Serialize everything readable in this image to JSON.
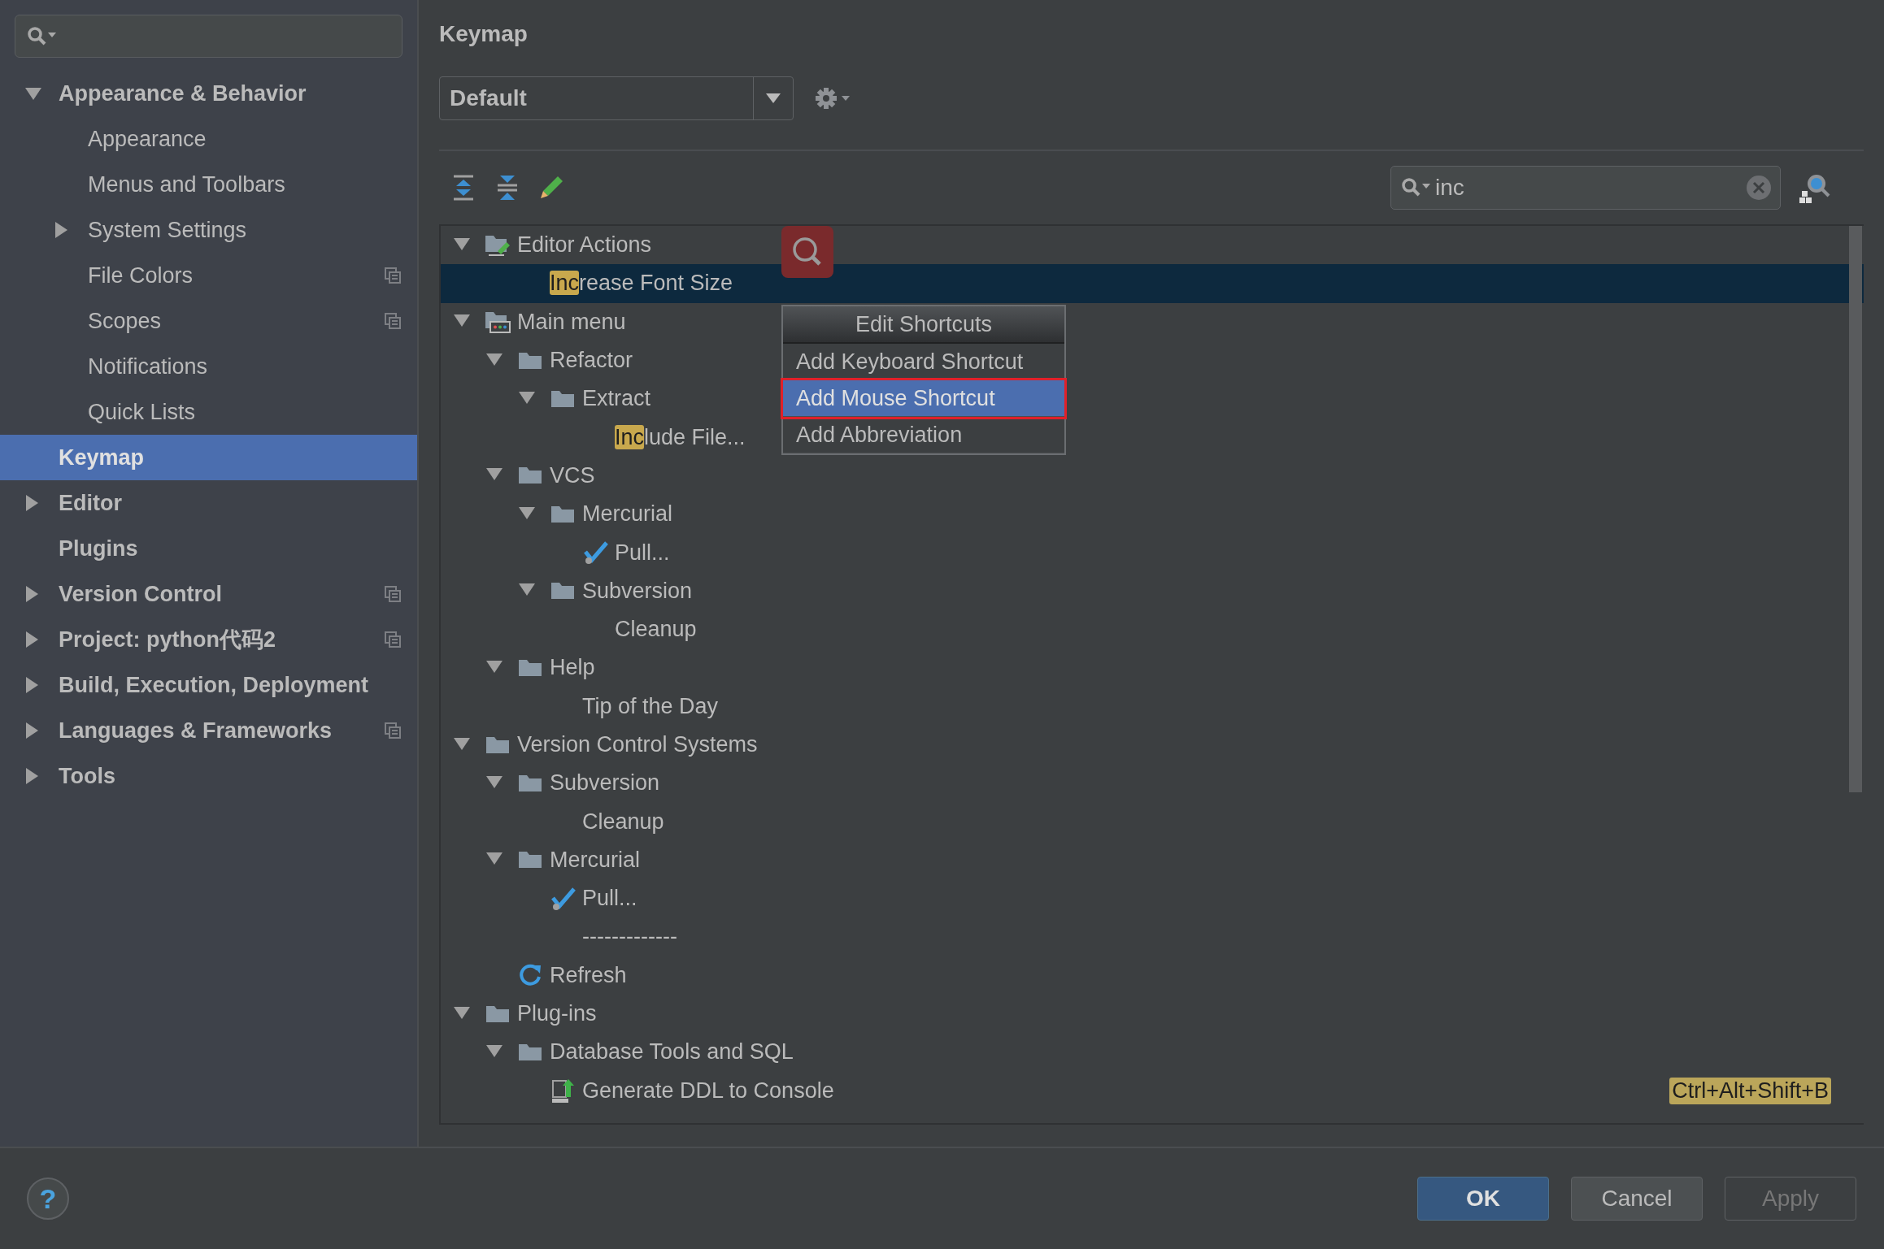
{
  "sidebar": {
    "items": [
      {
        "label": "Appearance & Behavior",
        "expandable": true,
        "expanded": true,
        "selected": false,
        "copy_icon": false,
        "children": [
          {
            "label": "Appearance",
            "expandable": false,
            "selected": false,
            "copy_icon": false
          },
          {
            "label": "Menus and Toolbars",
            "expandable": false,
            "selected": false,
            "copy_icon": false
          },
          {
            "label": "System Settings",
            "expandable": true,
            "expanded": false,
            "selected": false,
            "copy_icon": false
          },
          {
            "label": "File Colors",
            "expandable": false,
            "selected": false,
            "copy_icon": true
          },
          {
            "label": "Scopes",
            "expandable": false,
            "selected": false,
            "copy_icon": true
          },
          {
            "label": "Notifications",
            "expandable": false,
            "selected": false,
            "copy_icon": false
          },
          {
            "label": "Quick Lists",
            "expandable": false,
            "selected": false,
            "copy_icon": false
          }
        ]
      },
      {
        "label": "Keymap",
        "expandable": false,
        "selected": true,
        "copy_icon": false
      },
      {
        "label": "Editor",
        "expandable": true,
        "expanded": false,
        "selected": false,
        "copy_icon": false
      },
      {
        "label": "Plugins",
        "expandable": false,
        "selected": false,
        "copy_icon": false
      },
      {
        "label": "Version Control",
        "expandable": true,
        "expanded": false,
        "selected": false,
        "copy_icon": true
      },
      {
        "label": "Project: python代码2",
        "expandable": true,
        "expanded": false,
        "selected": false,
        "copy_icon": true
      },
      {
        "label": "Build, Execution, Deployment",
        "expandable": true,
        "expanded": false,
        "selected": false,
        "copy_icon": false
      },
      {
        "label": "Languages & Frameworks",
        "expandable": true,
        "expanded": false,
        "selected": false,
        "copy_icon": true
      },
      {
        "label": "Tools",
        "expandable": true,
        "expanded": false,
        "selected": false,
        "copy_icon": false
      }
    ]
  },
  "keymap": {
    "title": "Keymap",
    "scheme": "Default",
    "search": {
      "value": "inc"
    },
    "tree": [
      {
        "label": "Editor Actions",
        "kind": "editor-folder",
        "expandable": true,
        "expanded": true,
        "selected": false,
        "children": [
          {
            "highlight": "Inc",
            "label": "rease Font Size",
            "kind": "none",
            "expandable": false,
            "selected": true
          }
        ]
      },
      {
        "label": "Main menu",
        "kind": "menu-folder",
        "expandable": true,
        "expanded": true,
        "selected": false,
        "children": [
          {
            "label": "Refactor",
            "kind": "folder",
            "expandable": true,
            "expanded": true,
            "selected": false,
            "children": [
              {
                "label": "Extract",
                "kind": "folder",
                "expandable": true,
                "expanded": true,
                "selected": false,
                "children": [
                  {
                    "highlight": "Inc",
                    "label": "lude File...",
                    "kind": "none",
                    "expandable": false,
                    "selected": false
                  }
                ]
              }
            ]
          },
          {
            "label": "VCS",
            "kind": "folder",
            "expandable": true,
            "expanded": true,
            "selected": false,
            "children": [
              {
                "label": "Mercurial",
                "kind": "folder",
                "expandable": true,
                "expanded": true,
                "selected": false,
                "children": [
                  {
                    "label": "Pull...",
                    "kind": "pull",
                    "expandable": false,
                    "selected": false
                  }
                ]
              },
              {
                "label": "Subversion",
                "kind": "folder",
                "expandable": true,
                "expanded": true,
                "selected": false,
                "children": [
                  {
                    "label": "Cleanup",
                    "kind": "none",
                    "expandable": false,
                    "selected": false
                  }
                ]
              }
            ]
          },
          {
            "label": "Help",
            "kind": "folder",
            "expandable": true,
            "expanded": true,
            "selected": false,
            "children": [
              {
                "label": "Tip of the Day",
                "kind": "none",
                "expandable": false,
                "selected": false
              }
            ]
          }
        ]
      },
      {
        "label": "Version Control Systems",
        "kind": "folder",
        "expandable": true,
        "expanded": true,
        "selected": false,
        "children": [
          {
            "label": "Subversion",
            "kind": "folder",
            "expandable": true,
            "expanded": true,
            "selected": false,
            "children": [
              {
                "label": "Cleanup",
                "kind": "none",
                "expandable": false,
                "selected": false
              }
            ]
          },
          {
            "label": "Mercurial",
            "kind": "folder",
            "expandable": true,
            "expanded": true,
            "selected": false,
            "children": [
              {
                "label": "Pull...",
                "kind": "pull",
                "expandable": false,
                "selected": false
              },
              {
                "label": "-------------",
                "kind": "none",
                "expandable": false,
                "selected": false
              }
            ]
          },
          {
            "label": "Refresh",
            "kind": "refresh",
            "expandable": false,
            "selected": false
          }
        ]
      },
      {
        "label": "Plug-ins",
        "kind": "folder",
        "expandable": true,
        "expanded": true,
        "selected": false,
        "children": [
          {
            "label": "Database Tools and SQL",
            "kind": "folder",
            "expandable": true,
            "expanded": true,
            "selected": false,
            "children": [
              {
                "label": "Generate DDL to Console",
                "kind": "ddl",
                "expandable": false,
                "selected": false,
                "shortcut": "Ctrl+Alt+Shift+B"
              }
            ]
          }
        ]
      }
    ]
  },
  "popup": {
    "title": "Edit Shortcuts",
    "items": [
      {
        "label": "Add Keyboard Shortcut",
        "selected": false
      },
      {
        "label": "Add Mouse Shortcut",
        "selected": true
      },
      {
        "label": "Add Abbreviation",
        "selected": false
      }
    ]
  },
  "help": {
    "label": "?"
  },
  "buttons": [
    {
      "label": "OK",
      "default": true,
      "disabled": false
    },
    {
      "label": "Cancel",
      "default": false,
      "disabled": false
    },
    {
      "label": "Apply",
      "default": false,
      "disabled": true
    }
  ]
}
